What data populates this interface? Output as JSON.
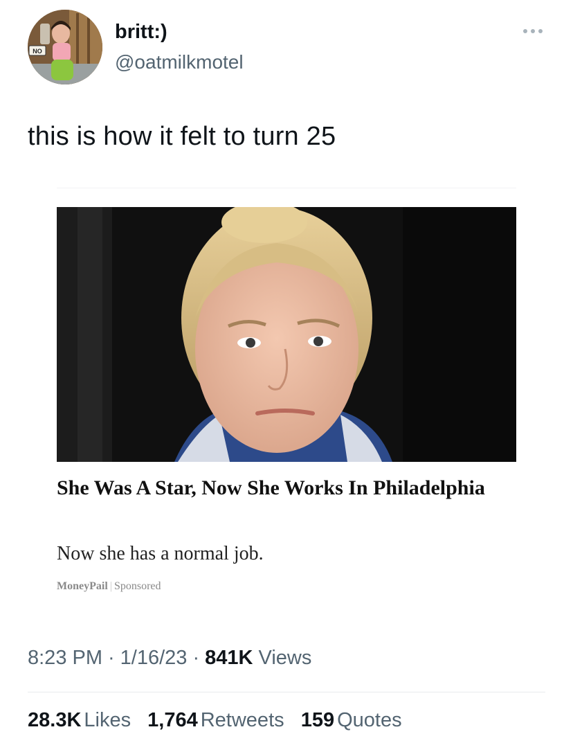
{
  "author": {
    "name": "britt:)",
    "handle": "@oatmilkmotel",
    "avatar_sign_text": "NO"
  },
  "tweet": {
    "text": "this is how it felt to turn 25"
  },
  "card": {
    "headline": "She Was A Star, Now She Works In Philadelphia",
    "subline": "Now she has a normal job.",
    "sponsor_brand": "MoneyPail",
    "sponsor_separator": "|",
    "sponsor_label": "Sponsored"
  },
  "meta": {
    "time": "8:23 PM",
    "date": "1/16/23",
    "views_count": "841K",
    "views_label": "Views",
    "dot": "·"
  },
  "stats": {
    "likes_count": "28.3K",
    "likes_label": "Likes",
    "retweets_count": "1,764",
    "retweets_label": "Retweets",
    "quotes_count": "159",
    "quotes_label": "Quotes"
  },
  "colors": {
    "text_primary": "#0f1419",
    "text_secondary": "#536471",
    "divider": "#e8ebed"
  },
  "icons": {
    "more": "more-horizontal-icon"
  }
}
